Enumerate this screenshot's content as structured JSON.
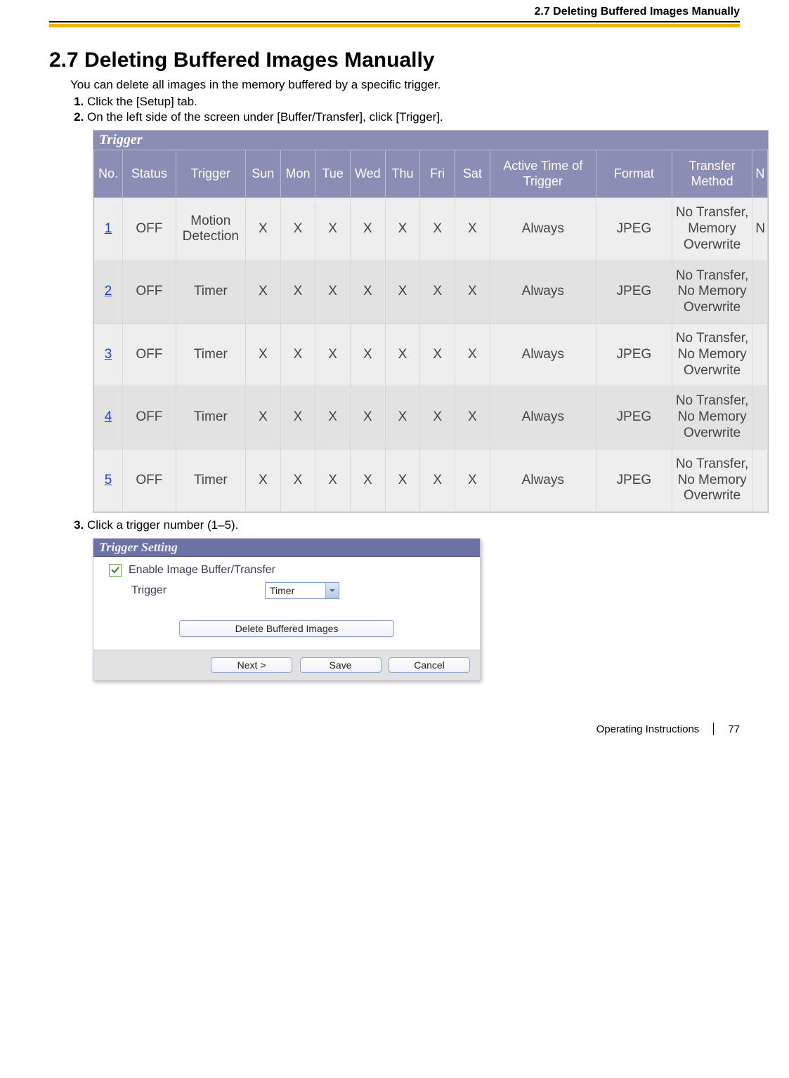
{
  "running_head": "2.7 Deleting Buffered Images Manually",
  "section_title": "2.7  Deleting Buffered Images Manually",
  "intro": "You can delete all images in the memory buffered by a specific trigger.",
  "steps": {
    "s1": "Click the [Setup] tab.",
    "s2": "On the left side of the screen under [Buffer/Transfer], click [Trigger].",
    "s3": "Click a trigger number (1–5)."
  },
  "trigger_table": {
    "panel_title": "Trigger",
    "headers": {
      "no": "No.",
      "status": "Status",
      "trigger": "Trigger",
      "sun": "Sun",
      "mon": "Mon",
      "tue": "Tue",
      "wed": "Wed",
      "thu": "Thu",
      "fri": "Fri",
      "sat": "Sat",
      "active": "Active Time of Trigger",
      "format": "Format",
      "transfer": "Transfer Method",
      "n": "N"
    },
    "rows": [
      {
        "no": "1",
        "status": "OFF",
        "trigger": "Motion Detection",
        "sun": "X",
        "mon": "X",
        "tue": "X",
        "wed": "X",
        "thu": "X",
        "fri": "X",
        "sat": "X",
        "active": "Always",
        "format": "JPEG",
        "transfer": "No Transfer, Memory Overwrite",
        "n": "N"
      },
      {
        "no": "2",
        "status": "OFF",
        "trigger": "Timer",
        "sun": "X",
        "mon": "X",
        "tue": "X",
        "wed": "X",
        "thu": "X",
        "fri": "X",
        "sat": "X",
        "active": "Always",
        "format": "JPEG",
        "transfer": "No Transfer, No Memory Overwrite",
        "n": ""
      },
      {
        "no": "3",
        "status": "OFF",
        "trigger": "Timer",
        "sun": "X",
        "mon": "X",
        "tue": "X",
        "wed": "X",
        "thu": "X",
        "fri": "X",
        "sat": "X",
        "active": "Always",
        "format": "JPEG",
        "transfer": "No Transfer, No Memory Overwrite",
        "n": ""
      },
      {
        "no": "4",
        "status": "OFF",
        "trigger": "Timer",
        "sun": "X",
        "mon": "X",
        "tue": "X",
        "wed": "X",
        "thu": "X",
        "fri": "X",
        "sat": "X",
        "active": "Always",
        "format": "JPEG",
        "transfer": "No Transfer, No Memory Overwrite",
        "n": ""
      },
      {
        "no": "5",
        "status": "OFF",
        "trigger": "Timer",
        "sun": "X",
        "mon": "X",
        "tue": "X",
        "wed": "X",
        "thu": "X",
        "fri": "X",
        "sat": "X",
        "active": "Always",
        "format": "JPEG",
        "transfer": "No Transfer, No Memory Overwrite",
        "n": ""
      }
    ]
  },
  "setting_panel": {
    "title": "Trigger Setting",
    "enable_label": "Enable Image Buffer/Transfer",
    "trigger_label": "Trigger",
    "trigger_value": "Timer",
    "delete_btn": "Delete Buffered Images",
    "next_btn": "Next >",
    "save_btn": "Save",
    "cancel_btn": "Cancel"
  },
  "footer": {
    "doc": "Operating Instructions",
    "page": "77"
  }
}
